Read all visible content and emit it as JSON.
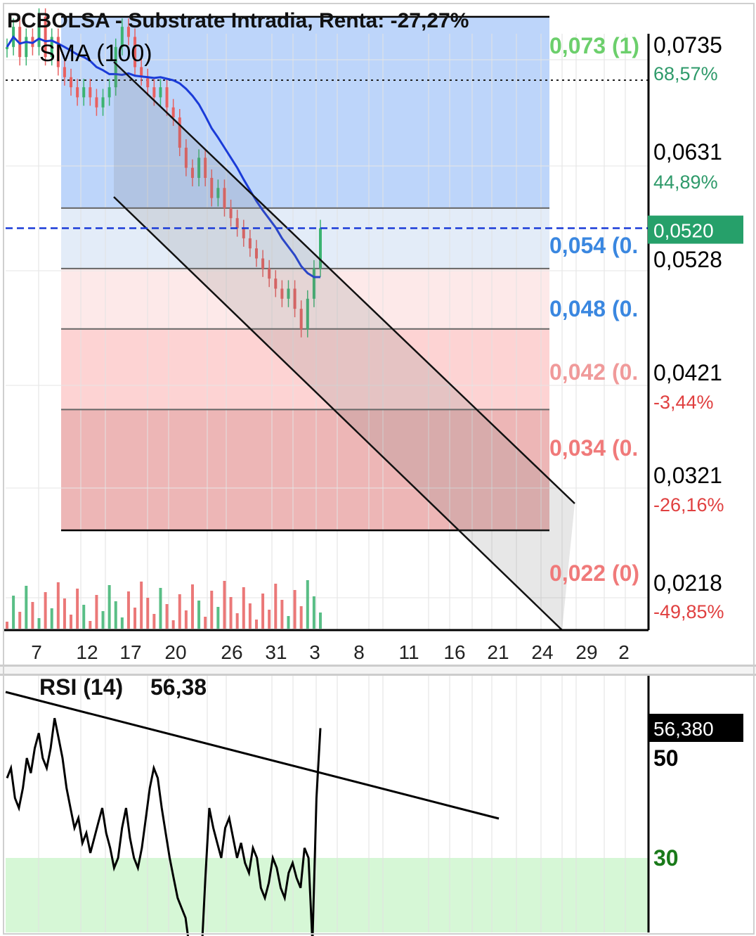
{
  "title": "PCBOLSA - Substrate Intradia, Renta: -27,27%",
  "colors": {
    "up": "#3cb371",
    "down": "#e86060",
    "sma": "#1a3bd8",
    "fib_top": "#bdd5fa",
    "fib_mid_blue": "#e3ecf8",
    "fib_mid_pink": "#fde9e9",
    "fib_low_pink": "#fdd3d3",
    "fib_bottom": "#edb6b6",
    "green_zone": "#d6f7d6",
    "price_badge": "#26a06a"
  },
  "price_axis": {
    "labels": [
      "0,0735",
      "0,0631",
      "0,0528",
      "0,0421",
      "0,0321",
      "0,0218"
    ],
    "percents": [
      "68,57%",
      "44,89%",
      "-3,44%",
      "-26,16%",
      "-49,85%"
    ],
    "current_price": "0,0520"
  },
  "fib_labels": [
    "0,073 (1)",
    "0,054 (0.",
    "0,048 (0.",
    "0,042 (0.",
    "0,034 (0.",
    "0,022 (0)"
  ],
  "sma_label": "SMA (100)",
  "date_labels": [
    "7",
    "12",
    "17",
    "20",
    "26",
    "31",
    "3",
    "8",
    "11",
    "16",
    "21",
    "24",
    "29",
    "2"
  ],
  "rsi": {
    "label": "RSI (14)",
    "value": "56,38",
    "badge": "56,380",
    "levels": [
      "50",
      "30"
    ]
  },
  "chart_data": [
    {
      "type": "candlestick",
      "title": "PCBOLSA - Substrate Intradia, Renta: -27,27%",
      "x_tick_labels": [
        "7",
        "12",
        "17",
        "20",
        "26",
        "31",
        "3",
        "8",
        "11",
        "16",
        "21",
        "24",
        "29",
        "2"
      ],
      "y_tick_labels": [
        "0,0735",
        "0,0631",
        "0,0528",
        "0,0421",
        "0,0321",
        "0,0218"
      ],
      "ylim": [
        0.0158,
        0.0776
      ],
      "close_series": [
        0.07,
        0.072,
        0.069,
        0.071,
        0.07,
        0.073,
        0.069,
        0.071,
        0.068,
        0.067,
        0.066,
        0.065,
        0.066,
        0.065,
        0.064,
        0.065,
        0.066,
        0.07,
        0.072,
        0.071,
        0.068,
        0.067,
        0.066,
        0.065,
        0.066,
        0.064,
        0.063,
        0.06,
        0.058,
        0.057,
        0.059,
        0.057,
        0.055,
        0.056,
        0.054,
        0.053,
        0.052,
        0.051,
        0.05,
        0.049,
        0.048,
        0.047,
        0.046,
        0.045,
        0.046,
        0.044,
        0.042,
        0.045,
        0.048,
        0.052
      ],
      "sma_label": "SMA (100)",
      "current_price": 0.052,
      "fibonacci_levels": [
        0.073,
        0.054,
        0.048,
        0.042,
        0.034,
        0.022
      ],
      "fib_level_labels": [
        "0,073 (1)",
        "0,054 (0.",
        "0,048 (0.",
        "0,042 (0.",
        "0,034 (0.",
        "0,022 (0)"
      ],
      "percent_labels": [
        "68,57%",
        "44,89%",
        "-3,44%",
        "-26,16%",
        "-49,85%"
      ]
    },
    {
      "type": "line",
      "title": "RSI (14)",
      "value": 56.38,
      "levels": [
        50,
        30
      ],
      "values": [
        46,
        48,
        42,
        40,
        44,
        50,
        47,
        52,
        55,
        50,
        48,
        52,
        58,
        54,
        50,
        44,
        40,
        36,
        38,
        33,
        35,
        31,
        34,
        37,
        40,
        35,
        32,
        28,
        30,
        36,
        40,
        34,
        30,
        28,
        32,
        38,
        44,
        48,
        46,
        40,
        35,
        30,
        26,
        22,
        20,
        18,
        12,
        10,
        14,
        10,
        26,
        40,
        36,
        33,
        30,
        36,
        38,
        34,
        30,
        33,
        29,
        27,
        32,
        30,
        24,
        22,
        25,
        30,
        28,
        24,
        22,
        27,
        29,
        26,
        24,
        32,
        30,
        13,
        42,
        56
      ]
    }
  ]
}
